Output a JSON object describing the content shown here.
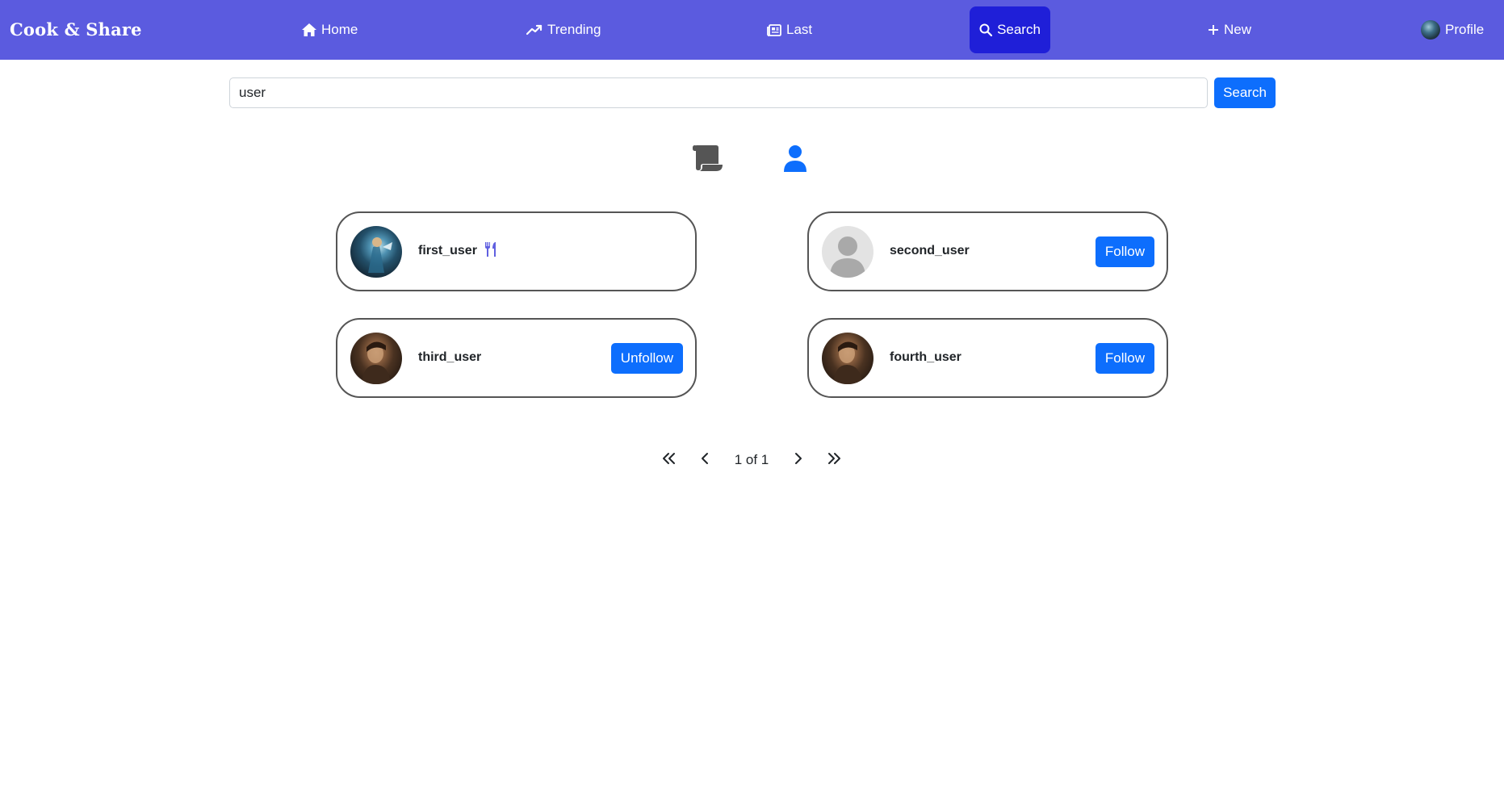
{
  "app": {
    "brand": "Cook & Share"
  },
  "nav": {
    "home": "Home",
    "trending": "Trending",
    "last": "Last",
    "search": "Search",
    "new": "New",
    "profile": "Profile"
  },
  "search": {
    "value": "user",
    "button_label": "Search"
  },
  "toggles": [
    {
      "icon": "scroll-icon",
      "label": "recipes",
      "active": false,
      "color": "#555555"
    },
    {
      "icon": "user-icon",
      "label": "users",
      "active": true,
      "color": "#0d6efd"
    }
  ],
  "users": [
    {
      "username": "first_user",
      "avatar": "hero-avatar",
      "is_self": true,
      "badge_icon": "utensils-icon"
    },
    {
      "username": "second_user",
      "avatar": "default-avatar",
      "action": "Follow"
    },
    {
      "username": "third_user",
      "avatar": "portrait-avatar",
      "action": "Unfollow"
    },
    {
      "username": "fourth_user",
      "avatar": "portrait-avatar",
      "action": "Follow"
    }
  ],
  "pagination": {
    "label": "1 of 1"
  },
  "colors": {
    "navbar": "#5b5bdf",
    "nav_active": "#1f1fd8",
    "primary": "#0d6efd",
    "card_border": "#555555",
    "chef_badge": "#6060e0"
  }
}
